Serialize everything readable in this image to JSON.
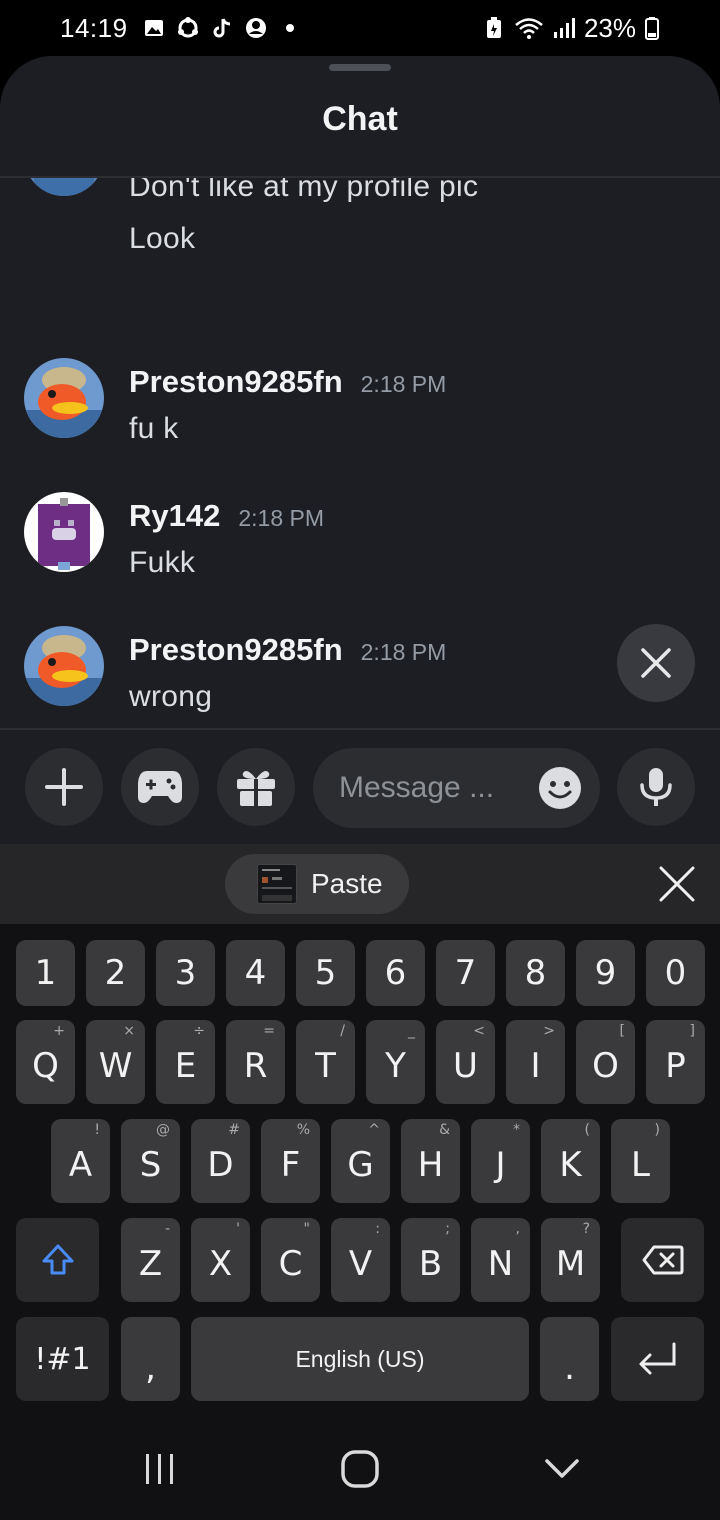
{
  "status_bar": {
    "time": "14:19",
    "battery_pct": "23%"
  },
  "sheet": {
    "title": "Chat"
  },
  "messages": [
    {
      "type": "continuation",
      "text": "Don't like at my profile pic"
    },
    {
      "type": "continuation",
      "text": "Look"
    },
    {
      "type": "message",
      "author": "Preston9285fn",
      "time": "2:18 PM",
      "text": "fu k"
    },
    {
      "type": "message",
      "author": "Ry142",
      "time": "2:18 PM",
      "text": "Fukk"
    },
    {
      "type": "message",
      "author": "Preston9285fn",
      "time": "2:18 PM",
      "text": "wrong"
    }
  ],
  "composer": {
    "placeholder": "Message ..."
  },
  "keyboard": {
    "paste_label": "Paste",
    "number_row": [
      "1",
      "2",
      "3",
      "4",
      "5",
      "6",
      "7",
      "8",
      "9",
      "0"
    ],
    "row1": [
      {
        "key": "Q",
        "sub": "+"
      },
      {
        "key": "W",
        "sub": "×"
      },
      {
        "key": "E",
        "sub": "÷"
      },
      {
        "key": "R",
        "sub": "="
      },
      {
        "key": "T",
        "sub": "/"
      },
      {
        "key": "Y",
        "sub": "_"
      },
      {
        "key": "U",
        "sub": "<"
      },
      {
        "key": "I",
        "sub": ">"
      },
      {
        "key": "O",
        "sub": "["
      },
      {
        "key": "P",
        "sub": "]"
      }
    ],
    "row2": [
      {
        "key": "A",
        "sub": "!"
      },
      {
        "key": "S",
        "sub": "@"
      },
      {
        "key": "D",
        "sub": "#"
      },
      {
        "key": "F",
        "sub": "%"
      },
      {
        "key": "G",
        "sub": "^"
      },
      {
        "key": "H",
        "sub": "&"
      },
      {
        "key": "J",
        "sub": "*"
      },
      {
        "key": "K",
        "sub": "("
      },
      {
        "key": "L",
        "sub": ")"
      }
    ],
    "row3": [
      {
        "key": "Z",
        "sub": "-"
      },
      {
        "key": "X",
        "sub": "'"
      },
      {
        "key": "C",
        "sub": "\""
      },
      {
        "key": "V",
        "sub": ":"
      },
      {
        "key": "B",
        "sub": ";"
      },
      {
        "key": "N",
        "sub": ","
      },
      {
        "key": "M",
        "sub": "?"
      }
    ],
    "symbols_label": "!#1",
    "comma_label": ",",
    "space_label": "English (US)",
    "period_label": "."
  },
  "colors": {
    "background": "#1d1e23",
    "surface": "#2b2d31",
    "key": "#3a3a3d",
    "accent_shift": "#4a8cf7"
  }
}
